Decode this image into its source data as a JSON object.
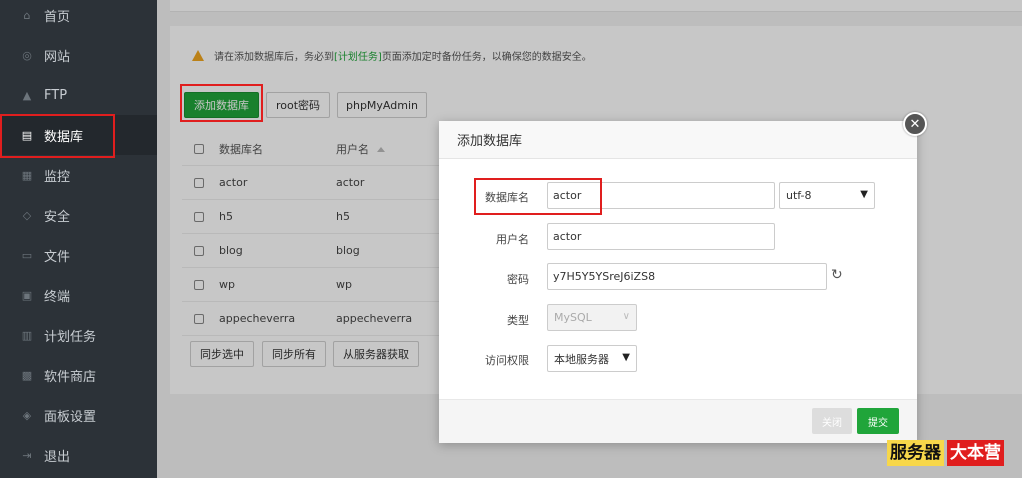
{
  "sidebar": {
    "items": [
      {
        "label": "首页",
        "icon": "home-icon",
        "glyph": "⌂"
      },
      {
        "label": "网站",
        "icon": "globe-icon",
        "glyph": "◎"
      },
      {
        "label": "FTP",
        "icon": "ftp-icon",
        "glyph": "▲"
      },
      {
        "label": "数据库",
        "icon": "database-icon",
        "glyph": "▤"
      },
      {
        "label": "监控",
        "icon": "monitor-icon",
        "glyph": "▦"
      },
      {
        "label": "安全",
        "icon": "shield-icon",
        "glyph": "◇"
      },
      {
        "label": "文件",
        "icon": "folder-icon",
        "glyph": "▭"
      },
      {
        "label": "终端",
        "icon": "terminal-icon",
        "glyph": "▣"
      },
      {
        "label": "计划任务",
        "icon": "calendar-icon",
        "glyph": "▥"
      },
      {
        "label": "软件商店",
        "icon": "apps-icon",
        "glyph": "▩"
      },
      {
        "label": "面板设置",
        "icon": "gear-icon",
        "glyph": "◈"
      },
      {
        "label": "退出",
        "icon": "logout-icon",
        "glyph": "⇥"
      }
    ]
  },
  "notice": {
    "before": "请在添加数据库后，务必到",
    "link": "[计划任务]",
    "after": "页面添加定时备份任务，以确保您的数据安全。"
  },
  "toolbar": {
    "add_db": "添加数据库",
    "root_pwd": "root密码",
    "phpmyadmin": "phpMyAdmin"
  },
  "table": {
    "headers": {
      "name": "数据库名",
      "user": "用户名"
    },
    "rows": [
      {
        "name": "actor",
        "user": "actor"
      },
      {
        "name": "h5",
        "user": "h5"
      },
      {
        "name": "blog",
        "user": "blog"
      },
      {
        "name": "wp",
        "user": "wp"
      },
      {
        "name": "appecheverra",
        "user": "appecheverra"
      }
    ]
  },
  "bottom_buttons": {
    "sync_selected": "同步选中",
    "sync_all": "同步所有",
    "fetch_server": "从服务器获取"
  },
  "modal": {
    "title": "添加数据库",
    "close_glyph": "✕",
    "fields": {
      "db_name_label": "数据库名",
      "db_name_value": "actor",
      "charset": "utf-8",
      "username_label": "用户名",
      "username_value": "actor",
      "password_label": "密码",
      "password_value": "y7H5Y5YSreJ6iZS8",
      "type_label": "类型",
      "type_value": "MySQL",
      "access_label": "访问权限",
      "access_value": "本地服务器"
    },
    "buttons": {
      "close": "关闭",
      "submit": "提交"
    }
  },
  "watermark": {
    "part1": "服务器",
    "part2": "大本营"
  },
  "colors": {
    "accent": "#20a53a",
    "highlight": "#e01e1e",
    "sidebar": "#2c3238",
    "warning": "#f0a61f"
  }
}
